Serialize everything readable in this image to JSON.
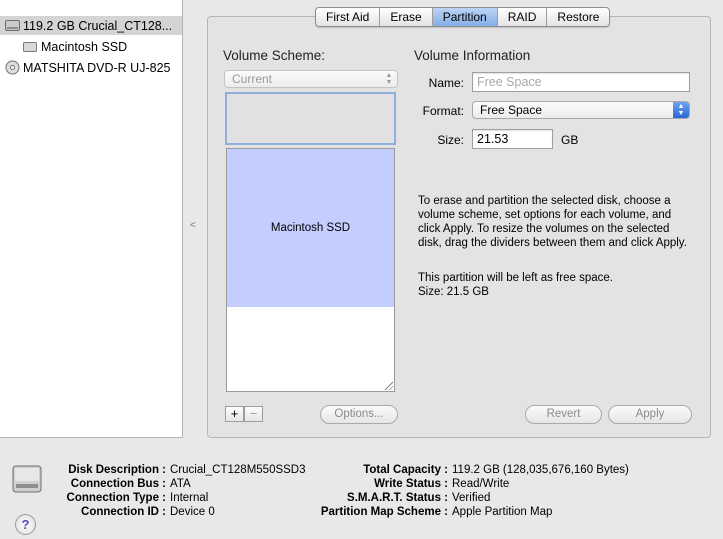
{
  "disks": [
    {
      "label": "119.2 GB Crucial_CT128...",
      "icon": "hard-disk-icon",
      "level": 0,
      "selected": true
    },
    {
      "label": "Macintosh SSD",
      "icon": "",
      "level": 1,
      "selected": false
    },
    {
      "label": "MATSHITA DVD-R UJ-825",
      "icon": "optical-drive-icon",
      "level": 0,
      "selected": false
    }
  ],
  "tabs": [
    "First Aid",
    "Erase",
    "Partition",
    "RAID",
    "Restore"
  ],
  "active_tab": "Partition",
  "volume_scheme": {
    "label": "Volume Scheme:",
    "popup_value": "Current",
    "partition_label": "Macintosh SSD"
  },
  "volume_info": {
    "label": "Volume Information",
    "name_label": "Name:",
    "name_placeholder": "Free Space",
    "format_label": "Format:",
    "format_value": "Free Space",
    "size_label": "Size:",
    "size_value": "21.53",
    "size_unit": "GB"
  },
  "description": {
    "paragraph1": "To erase and partition the selected disk, choose a volume scheme, set options for each volume, and click Apply. To resize the volumes on the selected disk, drag the dividers between them and click Apply.",
    "paragraph2_line1": "This partition will be left as free space.",
    "paragraph2_line2": "Size: 21.5 GB"
  },
  "buttons": {
    "add": "+",
    "remove": "−",
    "options": "Options...",
    "revert": "Revert",
    "apply": "Apply"
  },
  "info": {
    "left": [
      {
        "key": "Disk Description :",
        "value": "Crucial_CT128M550SSD3"
      },
      {
        "key": "Connection Bus :",
        "value": "ATA"
      },
      {
        "key": "Connection Type :",
        "value": "Internal"
      },
      {
        "key": "Connection ID :",
        "value": "Device 0"
      }
    ],
    "right": [
      {
        "key": "Total Capacity :",
        "value": "119.2 GB (128,035,676,160 Bytes)"
      },
      {
        "key": "Write Status :",
        "value": "Read/Write"
      },
      {
        "key": "S.M.A.R.T. Status :",
        "value": "Verified"
      },
      {
        "key": "Partition Map Scheme :",
        "value": "Apple Partition Map"
      }
    ]
  },
  "help_label": "?",
  "colors": {
    "selected_row": "#d4d4d4",
    "active_tab": "#84aee8",
    "partition_fill": "#c3cdfe",
    "selection_border": "#8fb0df"
  }
}
